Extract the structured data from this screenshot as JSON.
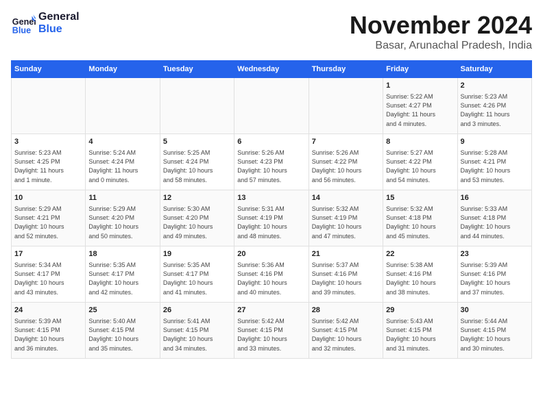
{
  "header": {
    "logo_line1": "General",
    "logo_line2": "Blue",
    "month": "November 2024",
    "location": "Basar, Arunachal Pradesh, India"
  },
  "days_of_week": [
    "Sunday",
    "Monday",
    "Tuesday",
    "Wednesday",
    "Thursday",
    "Friday",
    "Saturday"
  ],
  "weeks": [
    {
      "days": [
        {
          "number": "",
          "info": ""
        },
        {
          "number": "",
          "info": ""
        },
        {
          "number": "",
          "info": ""
        },
        {
          "number": "",
          "info": ""
        },
        {
          "number": "",
          "info": ""
        },
        {
          "number": "1",
          "info": "Sunrise: 5:22 AM\nSunset: 4:27 PM\nDaylight: 11 hours\nand 4 minutes."
        },
        {
          "number": "2",
          "info": "Sunrise: 5:23 AM\nSunset: 4:26 PM\nDaylight: 11 hours\nand 3 minutes."
        }
      ]
    },
    {
      "days": [
        {
          "number": "3",
          "info": "Sunrise: 5:23 AM\nSunset: 4:25 PM\nDaylight: 11 hours\nand 1 minute."
        },
        {
          "number": "4",
          "info": "Sunrise: 5:24 AM\nSunset: 4:24 PM\nDaylight: 11 hours\nand 0 minutes."
        },
        {
          "number": "5",
          "info": "Sunrise: 5:25 AM\nSunset: 4:24 PM\nDaylight: 10 hours\nand 58 minutes."
        },
        {
          "number": "6",
          "info": "Sunrise: 5:26 AM\nSunset: 4:23 PM\nDaylight: 10 hours\nand 57 minutes."
        },
        {
          "number": "7",
          "info": "Sunrise: 5:26 AM\nSunset: 4:22 PM\nDaylight: 10 hours\nand 56 minutes."
        },
        {
          "number": "8",
          "info": "Sunrise: 5:27 AM\nSunset: 4:22 PM\nDaylight: 10 hours\nand 54 minutes."
        },
        {
          "number": "9",
          "info": "Sunrise: 5:28 AM\nSunset: 4:21 PM\nDaylight: 10 hours\nand 53 minutes."
        }
      ]
    },
    {
      "days": [
        {
          "number": "10",
          "info": "Sunrise: 5:29 AM\nSunset: 4:21 PM\nDaylight: 10 hours\nand 52 minutes."
        },
        {
          "number": "11",
          "info": "Sunrise: 5:29 AM\nSunset: 4:20 PM\nDaylight: 10 hours\nand 50 minutes."
        },
        {
          "number": "12",
          "info": "Sunrise: 5:30 AM\nSunset: 4:20 PM\nDaylight: 10 hours\nand 49 minutes."
        },
        {
          "number": "13",
          "info": "Sunrise: 5:31 AM\nSunset: 4:19 PM\nDaylight: 10 hours\nand 48 minutes."
        },
        {
          "number": "14",
          "info": "Sunrise: 5:32 AM\nSunset: 4:19 PM\nDaylight: 10 hours\nand 47 minutes."
        },
        {
          "number": "15",
          "info": "Sunrise: 5:32 AM\nSunset: 4:18 PM\nDaylight: 10 hours\nand 45 minutes."
        },
        {
          "number": "16",
          "info": "Sunrise: 5:33 AM\nSunset: 4:18 PM\nDaylight: 10 hours\nand 44 minutes."
        }
      ]
    },
    {
      "days": [
        {
          "number": "17",
          "info": "Sunrise: 5:34 AM\nSunset: 4:17 PM\nDaylight: 10 hours\nand 43 minutes."
        },
        {
          "number": "18",
          "info": "Sunrise: 5:35 AM\nSunset: 4:17 PM\nDaylight: 10 hours\nand 42 minutes."
        },
        {
          "number": "19",
          "info": "Sunrise: 5:35 AM\nSunset: 4:17 PM\nDaylight: 10 hours\nand 41 minutes."
        },
        {
          "number": "20",
          "info": "Sunrise: 5:36 AM\nSunset: 4:16 PM\nDaylight: 10 hours\nand 40 minutes."
        },
        {
          "number": "21",
          "info": "Sunrise: 5:37 AM\nSunset: 4:16 PM\nDaylight: 10 hours\nand 39 minutes."
        },
        {
          "number": "22",
          "info": "Sunrise: 5:38 AM\nSunset: 4:16 PM\nDaylight: 10 hours\nand 38 minutes."
        },
        {
          "number": "23",
          "info": "Sunrise: 5:39 AM\nSunset: 4:16 PM\nDaylight: 10 hours\nand 37 minutes."
        }
      ]
    },
    {
      "days": [
        {
          "number": "24",
          "info": "Sunrise: 5:39 AM\nSunset: 4:15 PM\nDaylight: 10 hours\nand 36 minutes."
        },
        {
          "number": "25",
          "info": "Sunrise: 5:40 AM\nSunset: 4:15 PM\nDaylight: 10 hours\nand 35 minutes."
        },
        {
          "number": "26",
          "info": "Sunrise: 5:41 AM\nSunset: 4:15 PM\nDaylight: 10 hours\nand 34 minutes."
        },
        {
          "number": "27",
          "info": "Sunrise: 5:42 AM\nSunset: 4:15 PM\nDaylight: 10 hours\nand 33 minutes."
        },
        {
          "number": "28",
          "info": "Sunrise: 5:42 AM\nSunset: 4:15 PM\nDaylight: 10 hours\nand 32 minutes."
        },
        {
          "number": "29",
          "info": "Sunrise: 5:43 AM\nSunset: 4:15 PM\nDaylight: 10 hours\nand 31 minutes."
        },
        {
          "number": "30",
          "info": "Sunrise: 5:44 AM\nSunset: 4:15 PM\nDaylight: 10 hours\nand 30 minutes."
        }
      ]
    }
  ]
}
